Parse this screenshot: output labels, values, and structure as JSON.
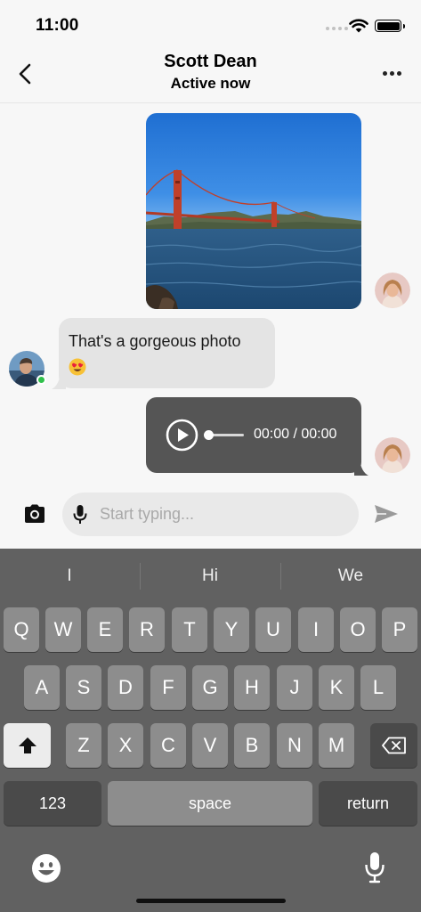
{
  "status_bar": {
    "time": "11:00"
  },
  "header": {
    "title": "Scott Dean",
    "subtitle": "Active now"
  },
  "messages": {
    "incoming_text": "That's a gorgeous photo",
    "audio_time": "00:00 / 00:00"
  },
  "composer": {
    "placeholder": "Start typing..."
  },
  "keyboard": {
    "suggestions": [
      "I",
      "Hi",
      "We"
    ],
    "row1": [
      "Q",
      "W",
      "E",
      "R",
      "T",
      "Y",
      "U",
      "I",
      "O",
      "P"
    ],
    "row2": [
      "A",
      "S",
      "D",
      "F",
      "G",
      "H",
      "J",
      "K",
      "L"
    ],
    "row3": [
      "Z",
      "X",
      "C",
      "V",
      "B",
      "N",
      "M"
    ],
    "numbers_label": "123",
    "space_label": "space",
    "return_label": "return"
  },
  "colors": {
    "background": "#f7f7f7",
    "incoming_bubble": "#e4e4e4",
    "outgoing_bubble": "#555555",
    "keyboard_bg": "#616161",
    "key": "#8d8d8d",
    "online": "#30c04b"
  },
  "icons": {
    "back": "chevron-left-icon",
    "more": "more-horizontal-icon",
    "camera": "camera-icon",
    "mic": "microphone-icon",
    "send": "send-icon",
    "play": "play-icon",
    "shift": "shift-icon",
    "backspace": "backspace-icon",
    "emoji": "emoji-icon",
    "dictation": "dictation-mic-icon"
  }
}
